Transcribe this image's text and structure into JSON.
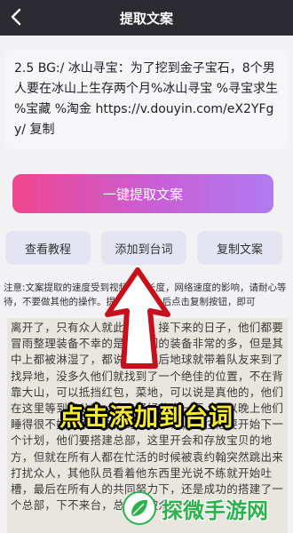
{
  "header": {
    "title": "提取文案"
  },
  "input": {
    "text": "2.5 BG:/ 冰山寻宝：为了挖到金子宝石，8个男人要在冰山上生存两个月%冰山寻宝 %寻宝求生 %宝藏 %淘金 https://v.douyin.com/eX2YFgy/ 复制"
  },
  "main_button": {
    "label": "一键提取文案"
  },
  "buttons": [
    {
      "label": "查看教程"
    },
    {
      "label": "添加到台词"
    },
    {
      "label": "复制文案"
    }
  ],
  "note": "注意:文案提取的速度受到视频时间长度，网络速度的影响，请耐心等待，不要做其他的操作。提取好文案之后点击复制按钮，即可",
  "background_text": "离开了，只有众人就此开始，接下来的日子，他们都要冒雨整理装备不幸的是，他们的装备非常的多，但是其中上都被淋湿了，都说好东西后地球就带着队友来到了找异地，没多久他们就找到了一个绝佳的位置，不在背靠大山，可以抵挡红包，菜地，可以说是真他的，他们在这里等到了公寓，晚上好好休息一下，所以晚上他们睡得很不好，不过今天的天气不错，就往他要开始下一个计划，他们要搭建总部，这里开会和存放宝贝的地方，但就在所有人都在忙活的时候被袁约翰突然跳出来打扰众人，其他队员看着他东西里光说不练就开始吐槽，最后在所有人的共同努力下，还是成功的搭建了一个总部，下不来台，总部就被众人",
  "caption": "点击添加到台词",
  "watermark": {
    "text": "探微手游网"
  }
}
